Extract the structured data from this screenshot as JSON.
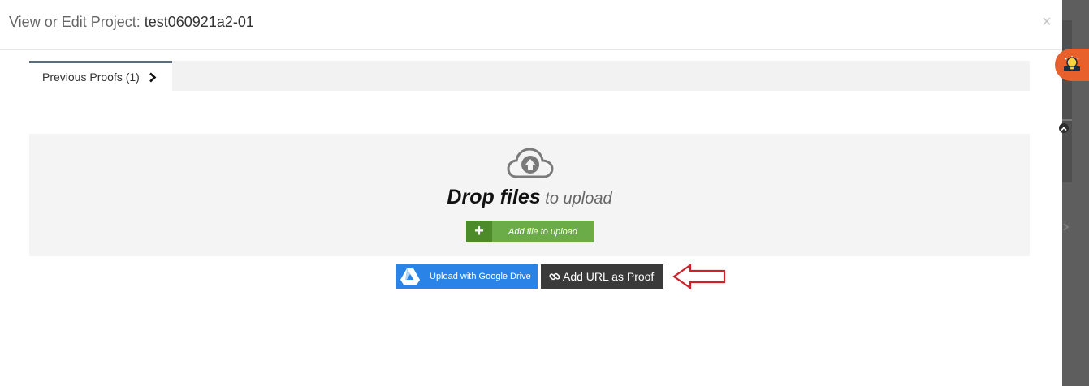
{
  "modal": {
    "title_prefix": "View or Edit Project: ",
    "project_name": "test060921a2-01",
    "close_symbol": "×"
  },
  "tabs": [
    {
      "label": "Previous Proofs (1)",
      "active": true
    }
  ],
  "drop_zone": {
    "heading_strong": "Drop files",
    "heading_rest": " to upload",
    "add_file_symbol": "+",
    "add_file_label": "Add file to upload"
  },
  "buttons": {
    "google_drive": "Upload with Google Drive",
    "add_url": "Add URL as Proof"
  },
  "icons": {
    "close": "close-icon",
    "tab_chevron": "chevron-right-icon",
    "upload": "cloud-upload-icon",
    "drive": "google-drive-icon",
    "link": "link-icon",
    "pointer": "arrow-left-icon",
    "help": "lightbulb-icon"
  },
  "colors": {
    "add_file_green": "#6cac48",
    "add_file_dark_green": "#4d8a2a",
    "drive_blue": "#2a83e6",
    "url_button": "#3a3a3a",
    "arrow_red": "#d0202a",
    "help_badge": "#e8602c"
  }
}
